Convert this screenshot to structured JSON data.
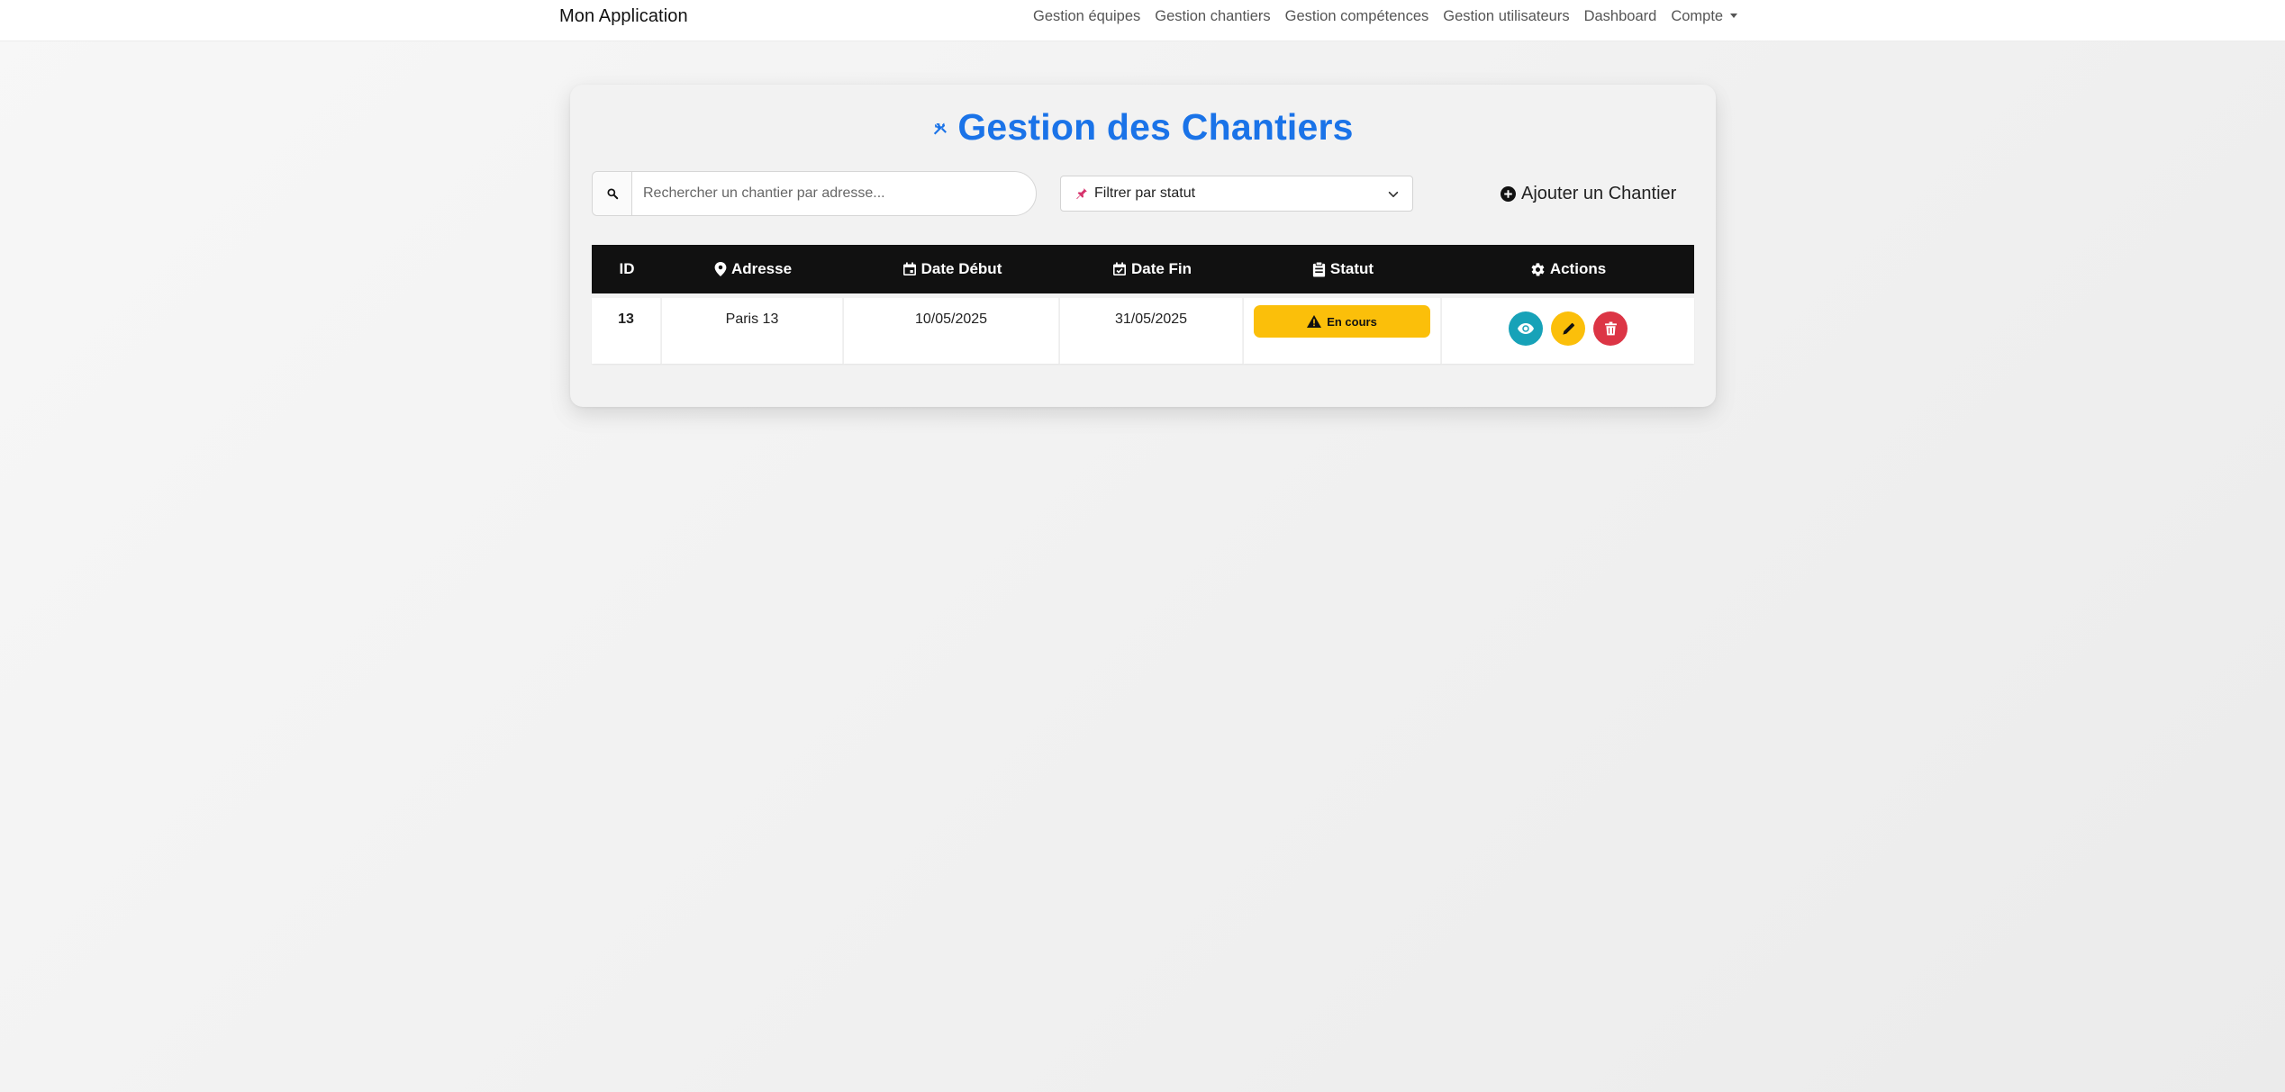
{
  "navbar": {
    "brand": "Mon Application",
    "links": [
      "Gestion équipes",
      "Gestion chantiers",
      "Gestion compétences",
      "Gestion utilisateurs",
      "Dashboard",
      "Compte"
    ]
  },
  "page": {
    "title": "Gestion des Chantiers",
    "accent_color": "#1a73e8"
  },
  "search": {
    "placeholder": "Rechercher un chantier par adresse...",
    "value": ""
  },
  "filter": {
    "selected": "Filtrer par statut"
  },
  "add_button": {
    "label": "Ajouter un Chantier"
  },
  "table": {
    "headers": {
      "id": "ID",
      "adresse": "Adresse",
      "date_debut": "Date Début",
      "date_fin": "Date Fin",
      "statut": "Statut",
      "actions": "Actions"
    },
    "rows": [
      {
        "id": "13",
        "adresse": "Paris 13",
        "date_debut": "10/05/2025",
        "date_fin": "31/05/2025",
        "statut": "En cours",
        "statut_color": "#fbbf0a"
      }
    ]
  },
  "action_buttons": {
    "view_color": "#17a2b8",
    "edit_color": "#fbbf0a",
    "delete_color": "#dc3545"
  }
}
